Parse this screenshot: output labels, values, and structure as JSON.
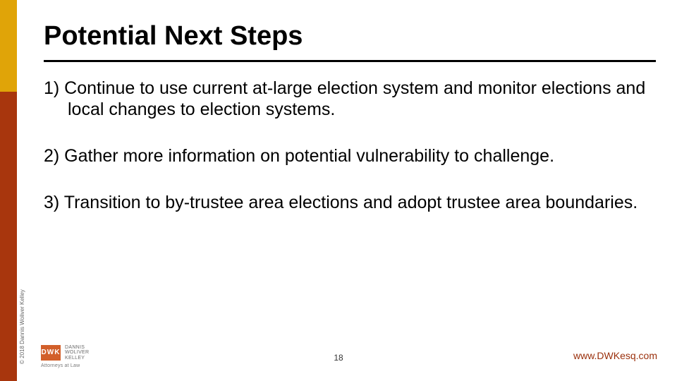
{
  "title": "Potential Next Steps",
  "bullets": [
    "1) Continue to use current at-large election system and monitor elections and local changes to election systems.",
    "2) Gather more information on potential vulnerability to challenge.",
    "3) Transition to by-trustee area elections and adopt trustee area boundaries."
  ],
  "copyright": "© 2018 Dannis Woliver Kelley",
  "logo": {
    "initials": "DWK",
    "side_line1": "DANNIS",
    "side_line2": "WOLIVER",
    "side_line3": "KELLEY",
    "tagline": "Attorneys at Law"
  },
  "page_number": "18",
  "url": "www.DWKesq.com"
}
